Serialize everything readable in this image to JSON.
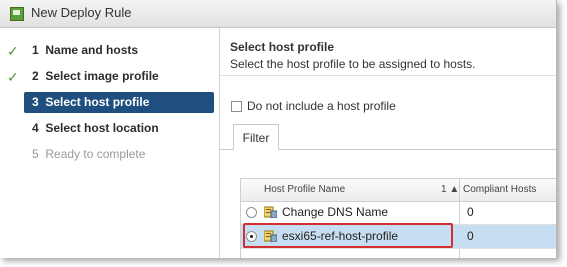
{
  "window": {
    "title": "New Deploy Rule"
  },
  "wizard": {
    "steps": [
      {
        "number": "1",
        "label": "Name and hosts",
        "status": "complete"
      },
      {
        "number": "2",
        "label": "Select image profile",
        "status": "complete"
      },
      {
        "number": "3",
        "label": "Select host profile",
        "status": "active"
      },
      {
        "number": "4",
        "label": "Select host location",
        "status": "pending"
      },
      {
        "number": "5",
        "label": "Ready to complete",
        "status": "disabled"
      }
    ]
  },
  "content": {
    "heading": "Select host profile",
    "subheading": "Select the host profile to be assigned to hosts.",
    "checkbox_label": "Do not include a host profile",
    "checkbox_checked": false,
    "tab_label": "Filter"
  },
  "grid": {
    "columns": [
      "Host Profile Name",
      "Compliant Hosts"
    ],
    "sort_indicator": "1 ▲",
    "rows": [
      {
        "name": "Change DNS Name",
        "compliant_hosts": "0",
        "selected": false
      },
      {
        "name": "esxi65-ref-host-profile",
        "compliant_hosts": "0",
        "selected": true
      }
    ]
  },
  "icons": {
    "check": "checkmark-icon",
    "profile": "host-profile-icon",
    "app": "deploy-rule-icon"
  },
  "colors": {
    "active_step_bg": "#1f4f7e",
    "check_green": "#4e9a3a",
    "selected_row_bg": "#c7ddf1",
    "highlight_red": "#d22f2f"
  }
}
